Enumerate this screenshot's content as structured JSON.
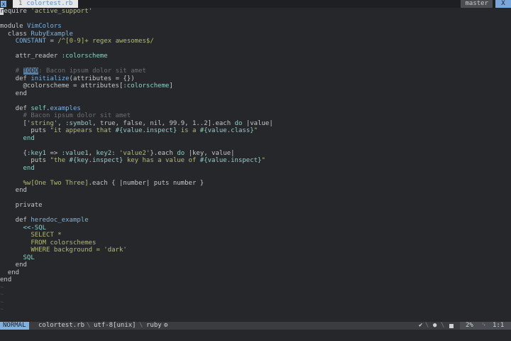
{
  "tabline": {
    "mark": "x",
    "tab_number": "1",
    "tab_filename": "colortest.rb",
    "branch": "master",
    "close": "X"
  },
  "editor": {
    "language": "ruby",
    "lines": [
      [
        {
          "t": "r",
          "c": "cursor"
        },
        {
          "t": "equire "
        },
        {
          "t": "'active_support'",
          "c": "str"
        }
      ],
      [
        {
          "t": ""
        }
      ],
      [
        {
          "t": "module "
        },
        {
          "t": "VimColors",
          "c": "cls"
        }
      ],
      [
        {
          "t": "  class "
        },
        {
          "t": "RubyExample",
          "c": "cls"
        }
      ],
      [
        {
          "t": "    "
        },
        {
          "t": "CONSTANT",
          "c": "cls"
        },
        {
          "t": " = "
        },
        {
          "t": "/^[0-9]+ regex awesomes$/",
          "c": "str"
        }
      ],
      [
        {
          "t": ""
        }
      ],
      [
        {
          "t": "    attr_reader "
        },
        {
          "t": ":colorscheme",
          "c": "sym"
        }
      ],
      [
        {
          "t": ""
        }
      ],
      [
        {
          "t": "    ",
          "c": "cmt"
        },
        {
          "t": "# ",
          "c": "cmt"
        },
        {
          "t": "TODO",
          "c": "todo"
        },
        {
          "t": ": Bacon ipsum dolor sit amet",
          "c": "cmt"
        }
      ],
      [
        {
          "t": "    def "
        },
        {
          "t": "initialize",
          "c": "cls"
        },
        {
          "t": "(attributes = {})"
        }
      ],
      [
        {
          "t": "      @colorscheme = attributes["
        },
        {
          "t": ":colorscheme",
          "c": "sym"
        },
        {
          "t": "]"
        }
      ],
      [
        {
          "t": "    end"
        }
      ],
      [
        {
          "t": ""
        }
      ],
      [
        {
          "t": "    def "
        },
        {
          "t": "self",
          "c": "sym"
        },
        {
          "t": "."
        },
        {
          "t": "examples",
          "c": "cls"
        }
      ],
      [
        {
          "t": "      # Bacon ipsum dolor sit amet",
          "c": "cmt"
        }
      ],
      [
        {
          "t": "      ["
        },
        {
          "t": "'string'",
          "c": "str"
        },
        {
          "t": ", "
        },
        {
          "t": ":symbol",
          "c": "sym"
        },
        {
          "t": ", true, false, nil, 99.9, 1..2].each "
        },
        {
          "t": "do",
          "c": "sym"
        },
        {
          "t": " |value|"
        }
      ],
      [
        {
          "t": "        puts "
        },
        {
          "t": "\"it appears that ",
          "c": "str"
        },
        {
          "t": "#{value.inspect}",
          "c": "interp"
        },
        {
          "t": " is a ",
          "c": "str"
        },
        {
          "t": "#{value.class}",
          "c": "interp"
        },
        {
          "t": "\"",
          "c": "str"
        }
      ],
      [
        {
          "t": "      end",
          "c": "sym"
        }
      ],
      [
        {
          "t": ""
        }
      ],
      [
        {
          "t": "      {"
        },
        {
          "t": ":key1",
          "c": "sym"
        },
        {
          "t": " => "
        },
        {
          "t": ":value1",
          "c": "sym"
        },
        {
          "t": ", "
        },
        {
          "t": "key2:",
          "c": "sym"
        },
        {
          "t": " "
        },
        {
          "t": "'value2'",
          "c": "str"
        },
        {
          "t": "}.each "
        },
        {
          "t": "do",
          "c": "sym"
        },
        {
          "t": " |key, value|"
        }
      ],
      [
        {
          "t": "        puts "
        },
        {
          "t": "\"the ",
          "c": "str"
        },
        {
          "t": "#{key.inspect}",
          "c": "interp"
        },
        {
          "t": " key has a value of ",
          "c": "str"
        },
        {
          "t": "#{value.inspect}",
          "c": "interp"
        },
        {
          "t": "\"",
          "c": "str"
        }
      ],
      [
        {
          "t": "      end",
          "c": "sym"
        }
      ],
      [
        {
          "t": ""
        }
      ],
      [
        {
          "t": "      "
        },
        {
          "t": "%w[One Two Three]",
          "c": "str"
        },
        {
          "t": ".each { |number| puts number }"
        }
      ],
      [
        {
          "t": "    end"
        }
      ],
      [
        {
          "t": ""
        }
      ],
      [
        {
          "t": "    private"
        }
      ],
      [
        {
          "t": ""
        }
      ],
      [
        {
          "t": "    def "
        },
        {
          "t": "heredoc_example",
          "c": "cls"
        }
      ],
      [
        {
          "t": "      "
        },
        {
          "t": "<<-SQL",
          "c": "sym"
        }
      ],
      [
        {
          "t": "        SELECT *",
          "c": "str"
        }
      ],
      [
        {
          "t": "        FROM colorschemes",
          "c": "str"
        }
      ],
      [
        {
          "t": "        WHERE background = 'dark'",
          "c": "str"
        }
      ],
      [
        {
          "t": "      "
        },
        {
          "t": "SQL",
          "c": "sym"
        }
      ],
      [
        {
          "t": "    end"
        }
      ],
      [
        {
          "t": "  end"
        }
      ],
      [
        {
          "t": "end"
        }
      ],
      [
        {
          "t": "~",
          "c": "tilde"
        }
      ],
      [
        {
          "t": "~",
          "c": "tilde"
        }
      ],
      [
        {
          "t": "~",
          "c": "tilde"
        }
      ],
      [
        {
          "t": "~",
          "c": "tilde"
        }
      ]
    ]
  },
  "statusline": {
    "mode": "NORMAL",
    "filename": "colortest.rb",
    "separator": "\\",
    "encoding": "utf-8[unix]",
    "filetype": "ruby",
    "filetype_icon": "⚙",
    "check": "✔",
    "dot": "●",
    "percent": "2%",
    "line_icon": "␊",
    "position": "1:1"
  },
  "colors": {
    "background": "#25272b",
    "accent": "#7aa6da",
    "string": "#b5bd68",
    "symbol": "#8fd0c8",
    "comment": "#6b6e73"
  }
}
